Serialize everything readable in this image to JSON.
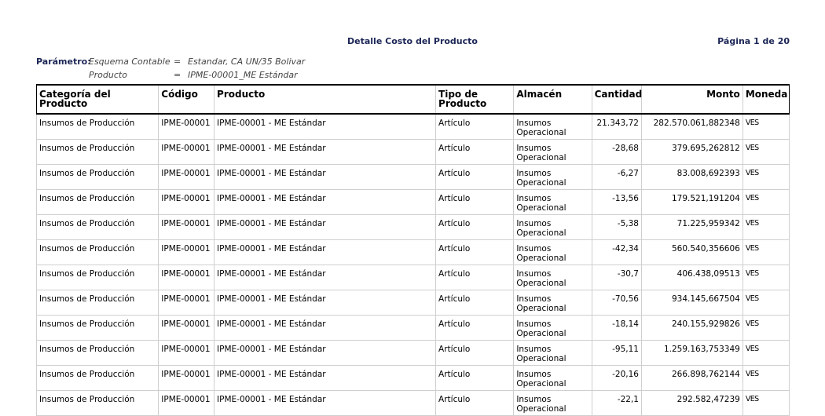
{
  "report": {
    "title": "Detalle Costo del Producto",
    "page_label": "Página 1 de 20"
  },
  "params": {
    "label": "Parámetro:",
    "rows": [
      {
        "name": "Esquema Contable",
        "eq": "=",
        "value": "Estandar, CA UN/35 Bolivar"
      },
      {
        "name": "Producto",
        "eq": "=",
        "value": "IPME-00001_ME Estándar"
      }
    ]
  },
  "table": {
    "headers": {
      "categoria": "Categoría del Producto",
      "codigo": "Código",
      "producto": "Producto",
      "tipo": "Tipo de Producto",
      "almacen": "Almacén",
      "cantidad": "Cantidad",
      "monto": "Monto",
      "moneda": "Moneda"
    },
    "rows": [
      {
        "categoria": "Insumos de Producción",
        "codigo": "IPME-00001",
        "producto": "IPME-00001 - ME Estándar",
        "tipo": "Artículo",
        "almacen": "Insumos Operacional",
        "cantidad": "21.343,72",
        "monto": "282.570.061,882348",
        "moneda": "VES"
      },
      {
        "categoria": "Insumos de Producción",
        "codigo": "IPME-00001",
        "producto": "IPME-00001 - ME Estándar",
        "tipo": "Artículo",
        "almacen": "Insumos Operacional",
        "cantidad": "-28,68",
        "monto": "379.695,262812",
        "moneda": "VES"
      },
      {
        "categoria": "Insumos de Producción",
        "codigo": "IPME-00001",
        "producto": "IPME-00001 - ME Estándar",
        "tipo": "Artículo",
        "almacen": "Insumos Operacional",
        "cantidad": "-6,27",
        "monto": "83.008,692393",
        "moneda": "VES"
      },
      {
        "categoria": "Insumos de Producción",
        "codigo": "IPME-00001",
        "producto": "IPME-00001 - ME Estándar",
        "tipo": "Artículo",
        "almacen": "Insumos Operacional",
        "cantidad": "-13,56",
        "monto": "179.521,191204",
        "moneda": "VES"
      },
      {
        "categoria": "Insumos de Producción",
        "codigo": "IPME-00001",
        "producto": "IPME-00001 - ME Estándar",
        "tipo": "Artículo",
        "almacen": "Insumos Operacional",
        "cantidad": "-5,38",
        "monto": "71.225,959342",
        "moneda": "VES"
      },
      {
        "categoria": "Insumos de Producción",
        "codigo": "IPME-00001",
        "producto": "IPME-00001 - ME Estándar",
        "tipo": "Artículo",
        "almacen": "Insumos Operacional",
        "cantidad": "-42,34",
        "monto": "560.540,356606",
        "moneda": "VES"
      },
      {
        "categoria": "Insumos de Producción",
        "codigo": "IPME-00001",
        "producto": "IPME-00001 - ME Estándar",
        "tipo": "Artículo",
        "almacen": "Insumos Operacional",
        "cantidad": "-30,7",
        "monto": "406.438,09513",
        "moneda": "VES"
      },
      {
        "categoria": "Insumos de Producción",
        "codigo": "IPME-00001",
        "producto": "IPME-00001 - ME Estándar",
        "tipo": "Artículo",
        "almacen": "Insumos Operacional",
        "cantidad": "-70,56",
        "monto": "934.145,667504",
        "moneda": "VES"
      },
      {
        "categoria": "Insumos de Producción",
        "codigo": "IPME-00001",
        "producto": "IPME-00001 - ME Estándar",
        "tipo": "Artículo",
        "almacen": "Insumos Operacional",
        "cantidad": "-18,14",
        "monto": "240.155,929826",
        "moneda": "VES"
      },
      {
        "categoria": "Insumos de Producción",
        "codigo": "IPME-00001",
        "producto": "IPME-00001 - ME Estándar",
        "tipo": "Artículo",
        "almacen": "Insumos Operacional",
        "cantidad": "-95,11",
        "monto": "1.259.163,753349",
        "moneda": "VES"
      },
      {
        "categoria": "Insumos de Producción",
        "codigo": "IPME-00001",
        "producto": "IPME-00001 - ME Estándar",
        "tipo": "Artículo",
        "almacen": "Insumos Operacional",
        "cantidad": "-20,16",
        "monto": "266.898,762144",
        "moneda": "VES"
      },
      {
        "categoria": "Insumos de Producción",
        "codigo": "IPME-00001",
        "producto": "IPME-00001 - ME Estándar",
        "tipo": "Artículo",
        "almacen": "Insumos Operacional",
        "cantidad": "-22,1",
        "monto": "292.582,47239",
        "moneda": "VES"
      }
    ]
  }
}
